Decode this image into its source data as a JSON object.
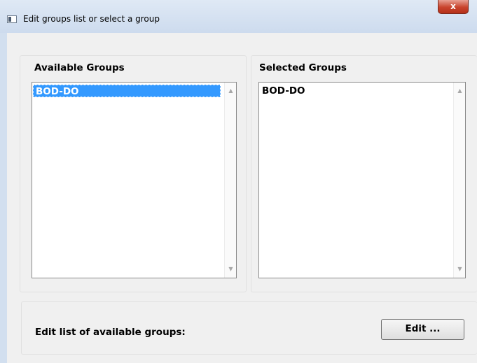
{
  "window": {
    "title": "Edit groups list or select a group",
    "close_label": "x"
  },
  "available": {
    "heading": "Available Groups",
    "items": [
      {
        "label": "BOD-DO",
        "selected": true
      }
    ]
  },
  "selected": {
    "heading": "Selected Groups",
    "items": [
      {
        "label": "BOD-DO",
        "selected": false
      }
    ]
  },
  "footer": {
    "label": "Edit list of available groups:",
    "edit_button": "Edit ..."
  },
  "scrollbar": {
    "up_glyph": "▲",
    "down_glyph": "▼"
  },
  "colors": {
    "selection": "#3399ff",
    "close_button": "#c8432c"
  }
}
